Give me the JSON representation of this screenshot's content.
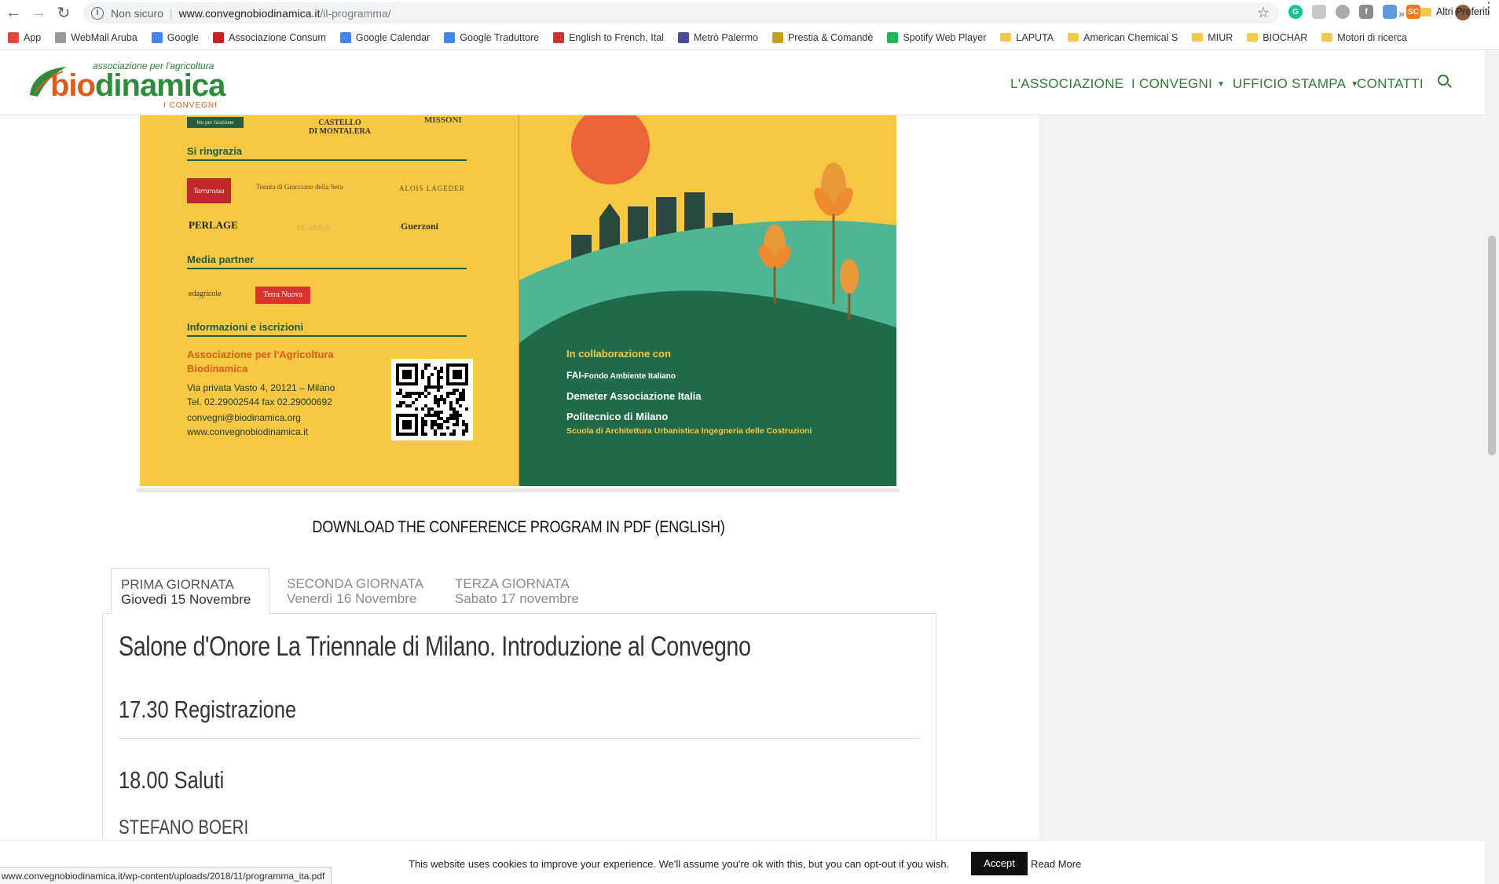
{
  "browser": {
    "security_label": "Non sicuro",
    "url_host": "www.convegnobiodinamica.it",
    "url_path": "/il-programma/",
    "status_url": "www.convegnobiodinamica.it/wp-content/uploads/2018/11/programma_ita.pdf"
  },
  "bookmarks": [
    {
      "label": "App",
      "icon": "apps-grid-icon",
      "color": "#e8453c"
    },
    {
      "label": "WebMail Aruba",
      "icon": "aruba-icon",
      "color": "#999999"
    },
    {
      "label": "Google",
      "icon": "google-icon",
      "color": "#4285f4"
    },
    {
      "label": "Associazione Consum",
      "icon": "consumer-icon",
      "color": "#cc1f1f"
    },
    {
      "label": "Google Calendar",
      "icon": "calendar-icon",
      "color": "#4285f4"
    },
    {
      "label": "Google Traduttore",
      "icon": "translate-icon",
      "color": "#4285f4"
    },
    {
      "label": "English to French, Ital",
      "icon": "wordreference-icon",
      "color": "#cc3333"
    },
    {
      "label": "Metrò Palermo",
      "icon": "metro-icon",
      "color": "#4a4aa0"
    },
    {
      "label": "Prestia & Comandè",
      "icon": "prestia-icon",
      "color": "#c8a020"
    },
    {
      "label": "Spotify Web Player",
      "icon": "spotify-icon",
      "color": "#1db954"
    },
    {
      "label": "LAPUTA",
      "icon": "folder-icon",
      "color": "#f2c94c"
    },
    {
      "label": "American Chemical S",
      "icon": "folder-icon",
      "color": "#f2c94c"
    },
    {
      "label": "MIUR",
      "icon": "folder-icon",
      "color": "#f2c94c"
    },
    {
      "label": "BIOCHAR",
      "icon": "folder-icon",
      "color": "#f2c94c"
    },
    {
      "label": "Motori di ricerca",
      "icon": "folder-icon",
      "color": "#f2c94c"
    }
  ],
  "bookmarks_more": "»",
  "bookmarks_other": "Altri Preferiti",
  "site": {
    "logo_tag": "associazione per l'agricoltura",
    "logo_bio": "bio",
    "logo_dinamica": "dinamica",
    "logo_sub": "I CONVEGNI",
    "nav": [
      {
        "label": "L'ASSOCIAZIONE",
        "dropdown": false
      },
      {
        "label": "I CONVEGNI",
        "dropdown": true
      },
      {
        "label": "UFFICIO STAMPA",
        "dropdown": true
      },
      {
        "label": "CONTATTI",
        "dropdown": false
      }
    ]
  },
  "poster": {
    "top_logo_small": "bio per ricezione",
    "top_logo_castello": "CASTELLO\nDI MONTALERA",
    "top_logo_missoni": "MISSONI",
    "thanks_heading": "Si ringrazia",
    "thanks_logos": [
      "Tarrarossa",
      "Tenuta di Gracciano della Seta",
      "ALOIS LAGEDER",
      "PERLAGE",
      "DE VAIRA",
      "Guerzoni"
    ],
    "media_heading": "Media partner",
    "media_logos": [
      "edagricole",
      "Terra Nuova"
    ],
    "info_heading": "Informazioni e iscrizioni",
    "org_name": "Associazione per l'Agricoltura Biodinamica",
    "address": "Via privata Vasto 4, 20121 – Milano",
    "phone": "Tel. 02.29002544 fax 02.29000692",
    "email": "convegni@biodinamica.org",
    "web": "www.convegnobiodinamica.it",
    "collab_heading": "In collaborazione con",
    "collab": [
      {
        "name": "FAI",
        "desc": "Fondo Ambiente Italiano"
      },
      {
        "name": "Demeter Associazione Italia",
        "desc": ""
      },
      {
        "name": "Politecnico di Milano",
        "desc": "Scuola di Architettura Urbanistica Ingegneria delle Costruzioni"
      }
    ]
  },
  "download_link": "DOWNLOAD THE CONFERENCE PROGRAM IN PDF (ENGLISH)",
  "tabs": [
    {
      "title": "PRIMA GIORNATA",
      "date": "Giovedì 15 Novembre",
      "active": true
    },
    {
      "title": "SECONDA GIORNATA",
      "date": "Venerdì 16 Novembre",
      "active": false
    },
    {
      "title": "TERZA GIORNATA",
      "date": "Sabato 17 novembre",
      "active": false
    }
  ],
  "panel": {
    "title": "Salone d'Onore La Triennale di Milano. Introduzione al Convegno",
    "items": [
      "17.30 Registrazione",
      "18.00 Saluti"
    ],
    "speaker": "STEFANO BOERI"
  },
  "cookie": {
    "text": "This website uses cookies to improve your experience. We'll assume you're ok with this, but you can opt-out if you wish.",
    "accept": "Accept",
    "read_more": "Read More"
  },
  "colors": {
    "brand_green": "#2e7d32",
    "brand_orange": "#e05a1b",
    "poster_yellow": "#f7c844",
    "poster_dark_green": "#1f6b4a",
    "poster_teal": "#4fb593"
  }
}
